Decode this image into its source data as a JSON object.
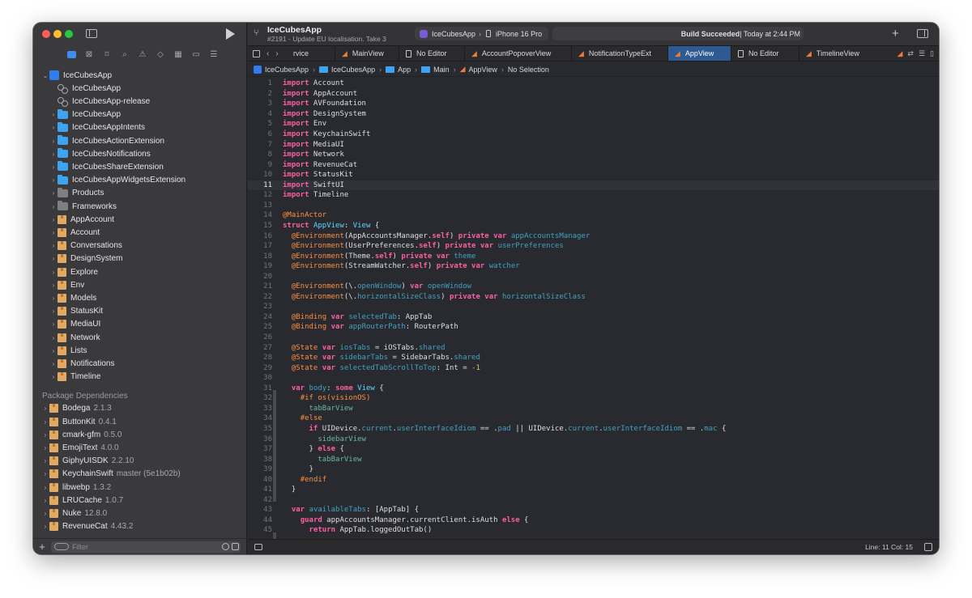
{
  "window": {
    "project_title": "IceCubesApp",
    "project_subtitle": "#2191 - Update EU localisation. Take 3"
  },
  "toolbar": {
    "scheme": "IceCubesApp",
    "destination": "iPhone 16 Pro",
    "build_status_bold": "Build Succeeded",
    "build_status_time": " | Today at 2:44 PM",
    "plus_glyph": "+"
  },
  "tabs": {
    "partial_first": "rvice",
    "items": [
      {
        "label": "MainView",
        "icon": "swift-icon"
      },
      {
        "label": "No Editor",
        "icon": "document-icon"
      },
      {
        "label": "AccountPopoverView",
        "icon": "swift-icon"
      },
      {
        "label": "NotificationTypeExt",
        "icon": "swift-icon"
      },
      {
        "label": "AppView",
        "icon": "swift-icon",
        "active": true
      },
      {
        "label": "No Editor",
        "icon": "document-icon"
      },
      {
        "label": "TimelineView",
        "icon": "swift-icon"
      }
    ]
  },
  "jumpbar": [
    "IceCubesApp",
    "IceCubesApp",
    "App",
    "Main",
    "AppView",
    "No Selection"
  ],
  "sidebar": {
    "tree": [
      {
        "label": "IceCubesApp",
        "icon": "project",
        "indent": 0,
        "expanded": true
      },
      {
        "label": "IceCubesApp",
        "icon": "scheme",
        "indent": 1
      },
      {
        "label": "IceCubesApp-release",
        "icon": "scheme",
        "indent": 1
      },
      {
        "label": "IceCubesApp",
        "icon": "folder",
        "indent": 1,
        "chevron": true
      },
      {
        "label": "IceCubesAppIntents",
        "icon": "folder",
        "indent": 1,
        "chevron": true
      },
      {
        "label": "IceCubesActionExtension",
        "icon": "folder",
        "indent": 1,
        "chevron": true
      },
      {
        "label": "IceCubesNotifications",
        "icon": "folder",
        "indent": 1,
        "chevron": true
      },
      {
        "label": "IceCubesShareExtension",
        "icon": "folder",
        "indent": 1,
        "chevron": true
      },
      {
        "label": "IceCubesAppWidgetsExtension",
        "icon": "folder",
        "indent": 1,
        "chevron": true
      },
      {
        "label": "Products",
        "icon": "graybox",
        "indent": 1,
        "chevron": true
      },
      {
        "label": "Frameworks",
        "icon": "graybox",
        "indent": 1,
        "chevron": true
      },
      {
        "label": "AppAccount",
        "icon": "package",
        "indent": 1,
        "chevron": true
      },
      {
        "label": "Account",
        "icon": "package",
        "indent": 1,
        "chevron": true
      },
      {
        "label": "Conversations",
        "icon": "package",
        "indent": 1,
        "chevron": true
      },
      {
        "label": "DesignSystem",
        "icon": "package",
        "indent": 1,
        "chevron": true
      },
      {
        "label": "Explore",
        "icon": "package",
        "indent": 1,
        "chevron": true
      },
      {
        "label": "Env",
        "icon": "package",
        "indent": 1,
        "chevron": true
      },
      {
        "label": "Models",
        "icon": "package",
        "indent": 1,
        "chevron": true
      },
      {
        "label": "StatusKit",
        "icon": "package",
        "indent": 1,
        "chevron": true
      },
      {
        "label": "MediaUI",
        "icon": "package",
        "indent": 1,
        "chevron": true
      },
      {
        "label": "Network",
        "icon": "package",
        "indent": 1,
        "chevron": true
      },
      {
        "label": "Lists",
        "icon": "package",
        "indent": 1,
        "chevron": true
      },
      {
        "label": "Notifications",
        "icon": "package",
        "indent": 1,
        "chevron": true
      },
      {
        "label": "Timeline",
        "icon": "package",
        "indent": 1,
        "chevron": true
      }
    ],
    "package_header": "Package Dependencies",
    "packages": [
      {
        "label": "Bodega",
        "version": "2.1.3"
      },
      {
        "label": "ButtonKit",
        "version": "0.4.1"
      },
      {
        "label": "cmark-gfm",
        "version": "0.5.0"
      },
      {
        "label": "EmojiText",
        "version": "4.0.0"
      },
      {
        "label": "GiphyUISDK",
        "version": "2.2.10"
      },
      {
        "label": "KeychainSwift",
        "version": "master (5e1b02b)"
      },
      {
        "label": "libwebp",
        "version": "1.3.2"
      },
      {
        "label": "LRUCache",
        "version": "1.0.7"
      },
      {
        "label": "Nuke",
        "version": "12.8.0"
      },
      {
        "label": "RevenueCat",
        "version": "4.43.2"
      }
    ],
    "filter_placeholder": "Filter",
    "add_glyph": "+"
  },
  "editor": {
    "current_line": 11,
    "lines": [
      [
        [
          "k",
          "import"
        ],
        [
          "pl",
          " Account"
        ]
      ],
      [
        [
          "k",
          "import"
        ],
        [
          "pl",
          " AppAccount"
        ]
      ],
      [
        [
          "k",
          "import"
        ],
        [
          "pl",
          " AVFoundation"
        ]
      ],
      [
        [
          "k",
          "import"
        ],
        [
          "pl",
          " DesignSystem"
        ]
      ],
      [
        [
          "k",
          "import"
        ],
        [
          "pl",
          " Env"
        ]
      ],
      [
        [
          "k",
          "import"
        ],
        [
          "pl",
          " KeychainSwift"
        ]
      ],
      [
        [
          "k",
          "import"
        ],
        [
          "pl",
          " MediaUI"
        ]
      ],
      [
        [
          "k",
          "import"
        ],
        [
          "pl",
          " Network"
        ]
      ],
      [
        [
          "k",
          "import"
        ],
        [
          "pl",
          " RevenueCat"
        ]
      ],
      [
        [
          "k",
          "import"
        ],
        [
          "pl",
          " StatusKit"
        ]
      ],
      [
        [
          "k",
          "import"
        ],
        [
          "pl",
          " SwiftUI"
        ]
      ],
      [
        [
          "k",
          "import"
        ],
        [
          "pl",
          " Timeline"
        ]
      ],
      [],
      [
        [
          "at",
          "@MainActor"
        ]
      ],
      [
        [
          "k",
          "struct"
        ],
        [
          "pl",
          " "
        ],
        [
          "ty",
          "AppView"
        ],
        [
          "pl",
          ": "
        ],
        [
          "ty",
          "View"
        ],
        [
          "pl",
          " {"
        ]
      ],
      [
        [
          "pl",
          "  "
        ],
        [
          "at",
          "@Environment"
        ],
        [
          "pl",
          "(AppAccountsManager."
        ],
        [
          "k",
          "self"
        ],
        [
          "pl",
          ") "
        ],
        [
          "k",
          "private"
        ],
        [
          "pl",
          " "
        ],
        [
          "k",
          "var"
        ],
        [
          "pl",
          " "
        ],
        [
          "mem",
          "appAccountsManager"
        ]
      ],
      [
        [
          "pl",
          "  "
        ],
        [
          "at",
          "@Environment"
        ],
        [
          "pl",
          "(UserPreferences."
        ],
        [
          "k",
          "self"
        ],
        [
          "pl",
          ") "
        ],
        [
          "k",
          "private"
        ],
        [
          "pl",
          " "
        ],
        [
          "k",
          "var"
        ],
        [
          "pl",
          " "
        ],
        [
          "mem",
          "userPreferences"
        ]
      ],
      [
        [
          "pl",
          "  "
        ],
        [
          "at",
          "@Environment"
        ],
        [
          "pl",
          "(Theme."
        ],
        [
          "k",
          "self"
        ],
        [
          "pl",
          ") "
        ],
        [
          "k",
          "private"
        ],
        [
          "pl",
          " "
        ],
        [
          "k",
          "var"
        ],
        [
          "pl",
          " "
        ],
        [
          "mem",
          "theme"
        ]
      ],
      [
        [
          "pl",
          "  "
        ],
        [
          "at",
          "@Environment"
        ],
        [
          "pl",
          "(StreamWatcher."
        ],
        [
          "k",
          "self"
        ],
        [
          "pl",
          ") "
        ],
        [
          "k",
          "private"
        ],
        [
          "pl",
          " "
        ],
        [
          "k",
          "var"
        ],
        [
          "pl",
          " "
        ],
        [
          "mem",
          "watcher"
        ]
      ],
      [],
      [
        [
          "pl",
          "  "
        ],
        [
          "at",
          "@Environment"
        ],
        [
          "pl",
          "(\\."
        ],
        [
          "mem",
          "openWindow"
        ],
        [
          "pl",
          ") "
        ],
        [
          "k",
          "var"
        ],
        [
          "pl",
          " "
        ],
        [
          "mem",
          "openWindow"
        ]
      ],
      [
        [
          "pl",
          "  "
        ],
        [
          "at",
          "@Environment"
        ],
        [
          "pl",
          "(\\."
        ],
        [
          "mem",
          "horizontalSizeClass"
        ],
        [
          "pl",
          ") "
        ],
        [
          "k",
          "private"
        ],
        [
          "pl",
          " "
        ],
        [
          "k",
          "var"
        ],
        [
          "pl",
          " "
        ],
        [
          "mem",
          "horizontalSizeClass"
        ]
      ],
      [],
      [
        [
          "pl",
          "  "
        ],
        [
          "at",
          "@Binding"
        ],
        [
          "pl",
          " "
        ],
        [
          "k",
          "var"
        ],
        [
          "pl",
          " "
        ],
        [
          "mem",
          "selectedTab"
        ],
        [
          "pl",
          ": AppTab"
        ]
      ],
      [
        [
          "pl",
          "  "
        ],
        [
          "at",
          "@Binding"
        ],
        [
          "pl",
          " "
        ],
        [
          "k",
          "var"
        ],
        [
          "pl",
          " "
        ],
        [
          "mem",
          "appRouterPath"
        ],
        [
          "pl",
          ": RouterPath"
        ]
      ],
      [],
      [
        [
          "pl",
          "  "
        ],
        [
          "at",
          "@State"
        ],
        [
          "pl",
          " "
        ],
        [
          "k",
          "var"
        ],
        [
          "pl",
          " "
        ],
        [
          "mem",
          "iosTabs"
        ],
        [
          "pl",
          " = iOSTabs."
        ],
        [
          "mem",
          "shared"
        ]
      ],
      [
        [
          "pl",
          "  "
        ],
        [
          "at",
          "@State"
        ],
        [
          "pl",
          " "
        ],
        [
          "k",
          "var"
        ],
        [
          "pl",
          " "
        ],
        [
          "mem",
          "sidebarTabs"
        ],
        [
          "pl",
          " = SidebarTabs."
        ],
        [
          "mem",
          "shared"
        ]
      ],
      [
        [
          "pl",
          "  "
        ],
        [
          "at",
          "@State"
        ],
        [
          "pl",
          " "
        ],
        [
          "k",
          "var"
        ],
        [
          "pl",
          " "
        ],
        [
          "mem",
          "selectedTabScrollToTop"
        ],
        [
          "pl",
          ": Int = "
        ],
        [
          "n",
          "-1"
        ]
      ],
      [],
      [
        [
          "pl",
          "  "
        ],
        [
          "k",
          "var"
        ],
        [
          "pl",
          " "
        ],
        [
          "mem",
          "body"
        ],
        [
          "pl",
          ": "
        ],
        [
          "k",
          "some"
        ],
        [
          "pl",
          " "
        ],
        [
          "ty",
          "View"
        ],
        [
          "pl",
          " {"
        ]
      ],
      [
        [
          "pl",
          "    "
        ],
        [
          "pp",
          "#if os(visionOS)"
        ]
      ],
      [
        [
          "pl",
          "      "
        ],
        [
          "fn",
          "tabBarView"
        ]
      ],
      [
        [
          "pl",
          "    "
        ],
        [
          "pp",
          "#else"
        ]
      ],
      [
        [
          "pl",
          "      "
        ],
        [
          "k",
          "if"
        ],
        [
          "pl",
          " UIDevice."
        ],
        [
          "mem",
          "current"
        ],
        [
          "pl",
          "."
        ],
        [
          "mem",
          "userInterfaceIdiom"
        ],
        [
          "pl",
          " == ."
        ],
        [
          "mem",
          "pad"
        ],
        [
          "pl",
          " || UIDevice."
        ],
        [
          "mem",
          "current"
        ],
        [
          "pl",
          "."
        ],
        [
          "mem",
          "userInterfaceIdiom"
        ],
        [
          "pl",
          " == ."
        ],
        [
          "mem",
          "mac"
        ],
        [
          "pl",
          " {"
        ]
      ],
      [
        [
          "pl",
          "        "
        ],
        [
          "fn",
          "sidebarView"
        ]
      ],
      [
        [
          "pl",
          "      } "
        ],
        [
          "k",
          "else"
        ],
        [
          "pl",
          " {"
        ]
      ],
      [
        [
          "pl",
          "        "
        ],
        [
          "fn",
          "tabBarView"
        ]
      ],
      [
        [
          "pl",
          "      }"
        ]
      ],
      [
        [
          "pl",
          "    "
        ],
        [
          "pp",
          "#endif"
        ]
      ],
      [
        [
          "pl",
          "  }"
        ]
      ],
      [],
      [
        [
          "pl",
          "  "
        ],
        [
          "k",
          "var"
        ],
        [
          "pl",
          " "
        ],
        [
          "mem",
          "availableTabs"
        ],
        [
          "pl",
          ": [AppTab] {"
        ]
      ],
      [
        [
          "pl",
          "    "
        ],
        [
          "k",
          "guard"
        ],
        [
          "pl",
          " appAccountsManager.currentClient.isAuth "
        ],
        [
          "k",
          "else"
        ],
        [
          "pl",
          " {"
        ]
      ],
      [
        [
          "pl",
          "      "
        ],
        [
          "k",
          "return"
        ],
        [
          "pl",
          " AppTab.loggedOutTab()"
        ]
      ]
    ]
  },
  "status": {
    "position": "Line: 11  Col: 15"
  }
}
